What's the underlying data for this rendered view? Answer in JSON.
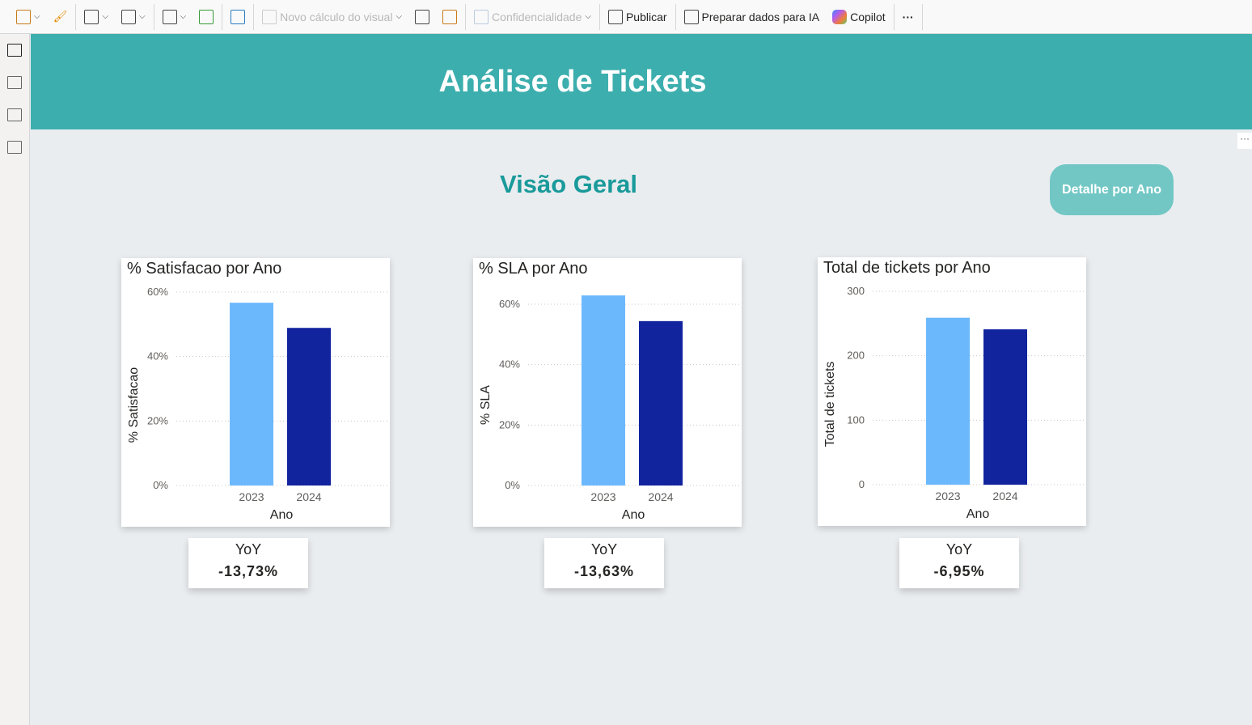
{
  "toolbar": {
    "items": [
      "Novo cálculo do visual",
      "Confidencialidade",
      "Publicar",
      "Preparar dados para IA",
      "Copilot",
      "···"
    ]
  },
  "report": {
    "title": "Análise de Tickets",
    "subtitle": "Visão Geral",
    "detail_button": "Detalhe por Ano",
    "more": "···"
  },
  "chart_data": [
    {
      "type": "bar",
      "title": "% Satisfacao por Ano",
      "xlabel": "Ano",
      "ylabel": "% Satisfacao",
      "categories": [
        "2023",
        "2024"
      ],
      "values": [
        56.7,
        48.9
      ],
      "ylim": [
        0,
        60
      ],
      "yticks": [
        "0%",
        "20%",
        "40%",
        "60%"
      ],
      "tickvals": [
        0,
        20,
        40,
        60
      ],
      "colors": [
        "#6cb8fc",
        "#12239e"
      ]
    },
    {
      "type": "bar",
      "title": "% SLA por Ano",
      "xlabel": "Ano",
      "ylabel": "% SLA",
      "categories": [
        "2023",
        "2024"
      ],
      "values": [
        62.9,
        54.4
      ],
      "ylim": [
        0,
        64
      ],
      "yticks": [
        "0%",
        "20%",
        "40%",
        "60%"
      ],
      "tickvals": [
        0,
        20,
        40,
        60
      ],
      "colors": [
        "#6cb8fc",
        "#12239e"
      ]
    },
    {
      "type": "bar",
      "title": "Total de tickets por Ano",
      "xlabel": "Ano",
      "ylabel": "Total de tickets",
      "categories": [
        "2023",
        "2024"
      ],
      "values": [
        259,
        241
      ],
      "ylim": [
        0,
        300
      ],
      "yticks": [
        "0",
        "100",
        "200",
        "300"
      ],
      "tickvals": [
        0,
        100,
        200,
        300
      ],
      "colors": [
        "#6cb8fc",
        "#12239e"
      ]
    }
  ],
  "yoy": [
    {
      "label": "YoY",
      "value": "-13,73%"
    },
    {
      "label": "YoY",
      "value": "-13,63%"
    },
    {
      "label": "YoY",
      "value": "-6,95%"
    }
  ]
}
